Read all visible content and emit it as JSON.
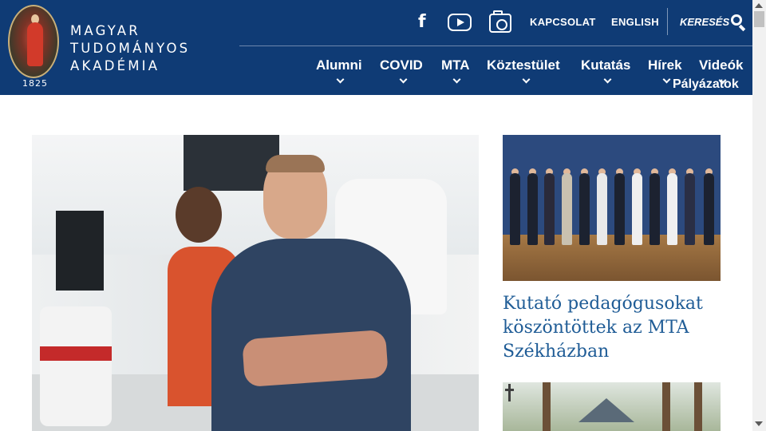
{
  "header": {
    "logo": {
      "lines": [
        "MAGYAR",
        "TUDOMÁNYOS",
        "AKADÉMIA"
      ],
      "year": "1825",
      "emblem_icon": "mta-emblem-icon"
    },
    "social": {
      "facebook_icon": "facebook-icon",
      "youtube_icon": "youtube-icon",
      "instagram_icon": "instagram-icon"
    },
    "top_links": {
      "contact": "KAPCSOLAT",
      "language": "ENGLISH",
      "search_label": "KERESÉS",
      "search_icon": "search-icon"
    },
    "nav": {
      "items": [
        {
          "label": "Alumni",
          "has_dropdown": true
        },
        {
          "label": "COVID",
          "has_dropdown": true
        },
        {
          "label": "MTA",
          "has_dropdown": true
        },
        {
          "label": "Köztestület",
          "has_dropdown": true
        },
        {
          "label": "Kutatás",
          "has_dropdown": true
        },
        {
          "label": "Hírek",
          "has_dropdown": true
        },
        {
          "label": "Videók",
          "has_dropdown": false
        },
        {
          "label": "Pályázatok",
          "has_dropdown": true
        }
      ]
    }
  },
  "main": {
    "hero_image": "researcher-in-laboratory-photo",
    "side_articles": [
      {
        "image": "award-ceremony-group-photo",
        "title": "Kutató pedagógusokat köszöntöttek az MTA Székházban"
      },
      {
        "image": "outdoor-gathering-photo",
        "title": ""
      }
    ]
  },
  "colors": {
    "header_bg": "#0f3b75",
    "link_blue": "#1f5c96",
    "white": "#ffffff"
  }
}
